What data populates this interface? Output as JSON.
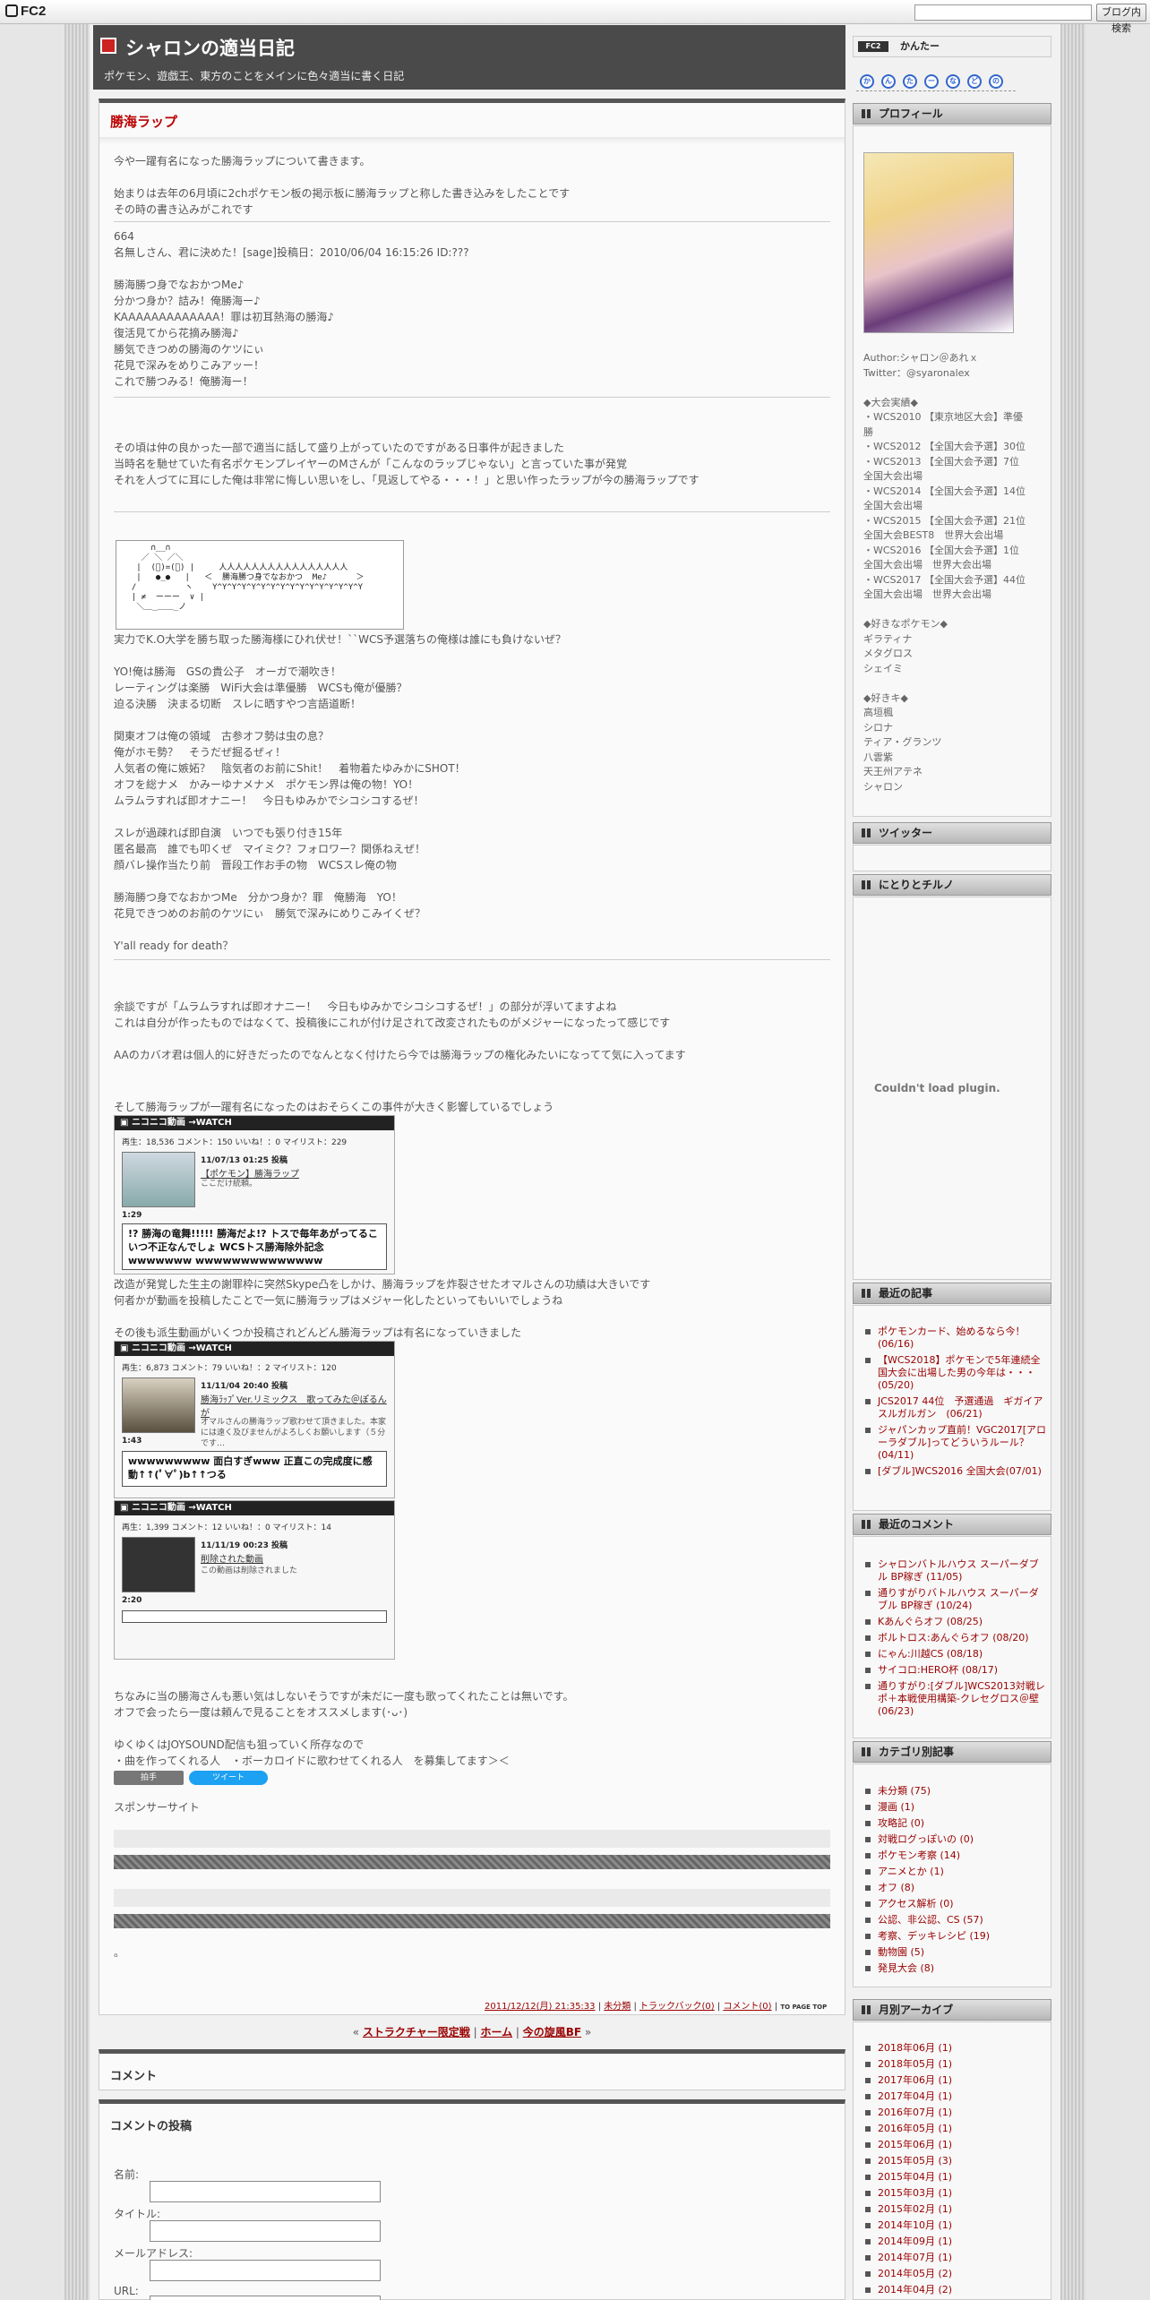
{
  "fc2": {
    "logo": "FC2",
    "search_button": "ブログ内検索"
  },
  "blog": {
    "title": "シャロンの適当日記",
    "description": "ポケモン、遊戯王、東方のことをメインに色々適当に書く日記"
  },
  "entry": {
    "title": "勝海ラップ",
    "p1": "今や一躍有名になった勝海ラップについて書きます。",
    "p2": "始まりは去年の6月頃に2chポケモン板の掲示板に勝海ラップと称した書き込みをしたことです\nその時の書き込みがこれです",
    "p3": "664\n名無しさん、君に決めた！[sage]投稿日：2010/06/04 16:15:26 ID:???\n\n勝海勝つ身でなおかつMe♪\n分かつ身か？詰み！俺勝海ー♪\nKAAAAAAAAAAAAA！罪は初耳熱海の勝海♪\n復活見てから花摘み勝海♪\n勝気できつめの勝海のケツにぃ\n花見で深みをめりこみアッー！\nこれで勝つみる！俺勝海ー！",
    "p4": "その頃は仲の良かった一部で適当に話して盛り上がっていたのですがある日事件が起きました\n当時名を馳せていた有名ポケモンプレイヤーのMさんが「こんなのラップじゃない」と言っていた事が発覚\nそれを人づてに耳にした俺は非常に悔しい思いをし、「見返してやる・・・！」と思い作ったラップが今の勝海ラップです",
    "aa": "      ∩__∩\n    ／ ＼ ／＼\n   |  (ﾟ)=(ﾟ) |     人人人人人人人人人人人人人人人人\n   |   ●_●   |   ＜  勝海勝つ身でなおかつ  Me♪      ＞\n  /          ヽ    Y^Y^Y^Y^Y^Y^Y^Y^Y^Y^Y^Y^Y^Y^Y^Y\n  | ≠  ーーー  ∨ |\n   ＼＿_＿＿_ノ",
    "p5": "実力でK.O大学を勝ち取った勝海様にひれ伏せ！``WCS予選落ちの俺様は誰にも負けないぜ？\n\nYO!俺は勝海　GSの貴公子　オーガで潮吹き！\nレーティングは楽勝　WiFi大会は準優勝　WCSも俺が優勝？\n迫る決勝　決まる切断　スレに晒すやつ言語道断！\n\n関東オフは俺の領域　古参オフ勢は虫の息？\n俺がホモ勢？　そうだぜ掘るぜィ！\n人気者の俺に嫉妬？　陰気者のお前にShit！　着物着たゆみかにSHOT！\nオフを総ナメ　かみーゆナメナメ　ポケモン界は俺の物！YO！\nムラムラすれば即オナニー！　今日もゆみかでシコシコするぜ！\n\nスレが過疎れば即自演　いつでも張り付き15年\n匿名最高　誰でも叩くぜ　マイミク？フォロワー？関係ねえぜ！\n顔バレ操作当たり前　晋段工作お手の物　WCSスレ俺の物\n\n勝海勝つ身でなおかつMe　分かつ身か？罪　俺勝海　YO！\n花見できつめのお前のケツにぃ　勝気で深みにめりこみイくぜ？\n\nY'all ready for death？",
    "p6": "余談ですが「ムラムラすれば即オナニー！　今日もゆみかでシコシコするぜ！」の部分が浮いてますよね\nこれは自分が作ったものではなくて、投稿後にこれが付け足されて改変されたものがメジャーになったって感じです\n\nAAのカバオ君は個人的に好きだったのでなんとなく付けたら今では勝海ラップの権化みたいになってて気に入ってます",
    "p7": "そして勝海ラップが一躍有名になったのはおそらくこの事件が大きく影響しているでしょう",
    "p8": "改造が発覚した生主の謝罪枠に突然Skype凸をしかけ、勝海ラップを炸裂させたオマルさんの功績は大きいです\n何者かが動画を投稿したことで一気に勝海ラップはメジャー化したといってもいいでしょうね\n\nその後も派生動画がいくつか投稿されどんどん勝海ラップは有名になっていきました",
    "p9": "ちなみに当の勝海さんも悪い気はしないそうですが未だに一度も歌ってくれたことは無いです。\nオフで会ったら一度は頼んで見ることをオススメします(･ᴗ･)\n\nゆくゆくはJOYSOUND配信も狙っていく所存なので\n・曲を作ってくれる人　・ボーカロイドに歌わせてくれる人　を募集してます＞＜",
    "sponsor": "スポンサーサイト",
    "dot": "。",
    "clap": "拍手",
    "tweet": "ツイート",
    "meta": {
      "date": "2011/12/12(月) 21:35:33",
      "category": "未分類",
      "trackback": "トラックバック(0)",
      "comment": "コメント(0)",
      "top": "TO PAGE TOP"
    }
  },
  "videos": [
    {
      "brand": "ニコニコ動画",
      "watch": "→WATCH",
      "stats": "再生：18,536 コメント：150 いいね！：0 マイリスト：229",
      "date": "11/07/13 01:25 投稿",
      "title": "【ポケモン】勝海ラップ",
      "desc": "ここだけ統頼。",
      "length": "1:29",
      "comment": "!? 勝海の竜舞!!!!! 勝海だよ!? トスで毎年あがってるこいつ不正なんでしょ WCSトス勝海除外記念 wwwwwww wwwwwwwwwwwwww wwwwwwwwwwwwww"
    },
    {
      "brand": "ニコニコ動画",
      "watch": "→WATCH",
      "stats": "再生：6,873 コメント：79 いいね！：2 マイリスト：120",
      "date": "11/11/04 20:40 投稿",
      "title": "勝海ﾗｯﾌﾟVer.リミックス　歌ってみた＠ぽるんが",
      "desc": "オマルさんの勝海ラップ歌わせて頂きました。本家には遠く及びませんがよろしくお願いします（５分です…",
      "length": "1:43",
      "comment": "wwwwwwwww 面白すぎwww 正直この完成度に感動↑↑(ﾟ∀ﾟ)b↑↑つる"
    },
    {
      "brand": "ニコニコ動画",
      "watch": "→WATCH",
      "stats": "再生：1,399 コメント：12 いいね！：0 マイリスト：14",
      "date": "11/11/19 00:23 投稿",
      "title": "削除された動画",
      "desc": "この動画は削除されました",
      "length": "2:20",
      "comment": ""
    }
  ],
  "pager": {
    "prev": "ストラクチャー限定戦",
    "home": "ホーム",
    "next": "今の旋風BF",
    "sep1": " | ",
    "sep2": " | ",
    "lq": "« ",
    "rq": " »"
  },
  "comments": {
    "title": "コメント"
  },
  "comment_form": {
    "title": "コメントの投稿",
    "name": "名前:",
    "subject": "タイトル:",
    "mail": "メールアドレス:",
    "url": "URL:"
  },
  "sidebar": {
    "kantan": "かんたー",
    "kantan_badge": "FC2",
    "bubbles": [
      "か",
      "ん",
      "た",
      "ー",
      "な",
      "ど",
      "の"
    ],
    "profile": {
      "title": "プロフィール",
      "text": "Author:シャロン＠あれｘ\nTwitter：@syaronalex\n\n◆大会実績◆\n・WCS2010 【東京地区大会】準優\n勝\n・WCS2012 【全国大会予選】30位\n・WCS2013 【全国大会予選】7位\n全国大会出場\n・WCS2014 【全国大会予選】14位\n全国大会出場\n・WCS2015 【全国大会予選】21位\n全国大会BEST8　世界大会出場\n・WCS2016 【全国大会予選】1位\n全国大会出場　世界大会出場\n・WCS2017 【全国大会予選】44位\n全国大会出場　世界大会出場\n\n◆好きなポケモン◆\nギラティナ\nメタグロス\nシェイミ\n\n◆好きキ◆\n高垣楓\nシロナ\nティア・グランツ\n八雲紫\n天王州アテネ\nシャロン"
    },
    "twitter": {
      "title": "ツイッター"
    },
    "nitori": {
      "title": "にとりとチルノ",
      "plugin": "Couldn't load plugin."
    },
    "recent_entries": {
      "title": "最近の記事",
      "items": [
        "ポケモンカード、始めるなら今！(06/16)",
        "【WCS2018】ポケモンで5年連続全国大会に出場した男の今年は・・・(05/20)",
        "JCS2017 44位　予選通過　ギガイアスルガルガン　(06/21)",
        "ジャパンカップ直前！VGC2017[アローラダブル]ってどういうルール？(04/11)",
        "[ダブル]WCS2016 全国大会(07/01)"
      ]
    },
    "recent_comments": {
      "title": "最近のコメント",
      "items": [
        "シャロンバトルハウス スーパーダブル BP稼ぎ (11/05)",
        "通りすがりバトルハウス スーパーダブル BP稼ぎ (10/24)",
        "Kあんぐらオフ (08/25)",
        "ボルトロス:あんぐらオフ (08/20)",
        "にゃん:川越CS (08/18)",
        "サイコロ:HERO杯 (08/17)",
        "通りすがり:[ダブル]WCS2013対戦レポ＋本戦使用構築-クレセグロス＠壁 (06/23)"
      ]
    },
    "categories": {
      "title": "カテゴリ別記事",
      "items": [
        "未分類 (75)",
        "漫画 (1)",
        "攻略記 (0)",
        "対戦ログっぽいの (0)",
        "ポケモン考察 (14)",
        "アニメとか (1)",
        "オフ (8)",
        "アクセス解析 (0)",
        "公認、非公認、CS (57)",
        "考察、デッキレシピ (19)",
        "動物園 (5)",
        "発見大会 (8)"
      ]
    },
    "archive": {
      "title": "月別アーカイブ",
      "items": [
        "2018年06月 (1)",
        "2018年05月 (1)",
        "2017年06月 (1)",
        "2017年04月 (1)",
        "2016年07月 (1)",
        "2016年05月 (1)",
        "2015年06月 (1)",
        "2015年05月 (3)",
        "2015年04月 (1)",
        "2015年03月 (1)",
        "2015年02月 (1)",
        "2014年10月 (1)",
        "2014年09月 (1)",
        "2014年07月 (1)",
        "2014年05月 (2)",
        "2014年04月 (2)"
      ]
    }
  }
}
